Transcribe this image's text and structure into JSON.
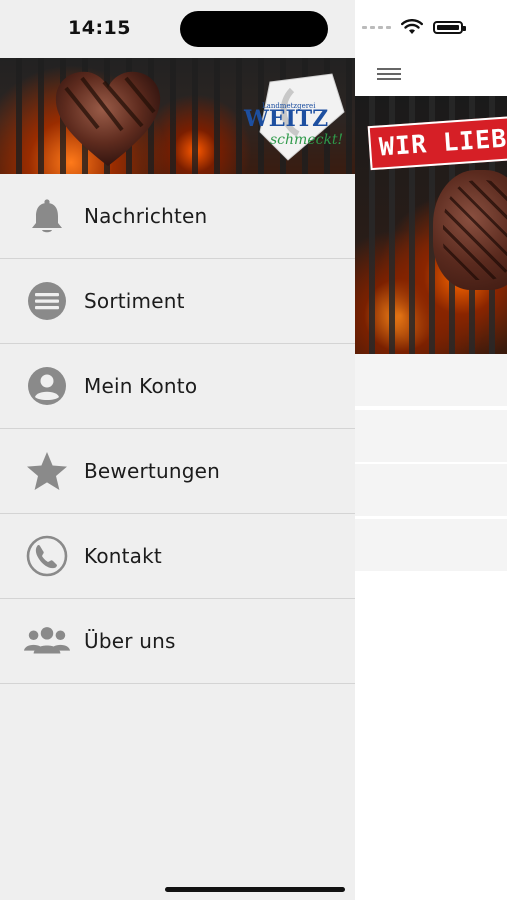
{
  "status_bar": {
    "time": "14:15"
  },
  "header": {
    "menu_icon": "hamburger-icon"
  },
  "banner": {
    "sign_text": "WIR LIEBEN"
  },
  "logo": {
    "brand": "WEITZ",
    "tagline": "Landmetzgerei",
    "slogan": "schmeckt!"
  },
  "drawer": {
    "items": [
      {
        "label": "Nachrichten",
        "icon": "bell-icon"
      },
      {
        "label": "Sortiment",
        "icon": "list-icon"
      },
      {
        "label": "Mein Konto",
        "icon": "account-icon"
      },
      {
        "label": "Bewertungen",
        "icon": "star-icon"
      },
      {
        "label": "Kontakt",
        "icon": "phone-icon"
      },
      {
        "label": "Über uns",
        "icon": "group-icon"
      }
    ]
  },
  "colors": {
    "drawer_bg": "#efefef",
    "icon_gray": "#888888",
    "sign_red": "#d61f26",
    "logo_blue": "#1d4fa0",
    "logo_green": "#2f9a4a"
  }
}
